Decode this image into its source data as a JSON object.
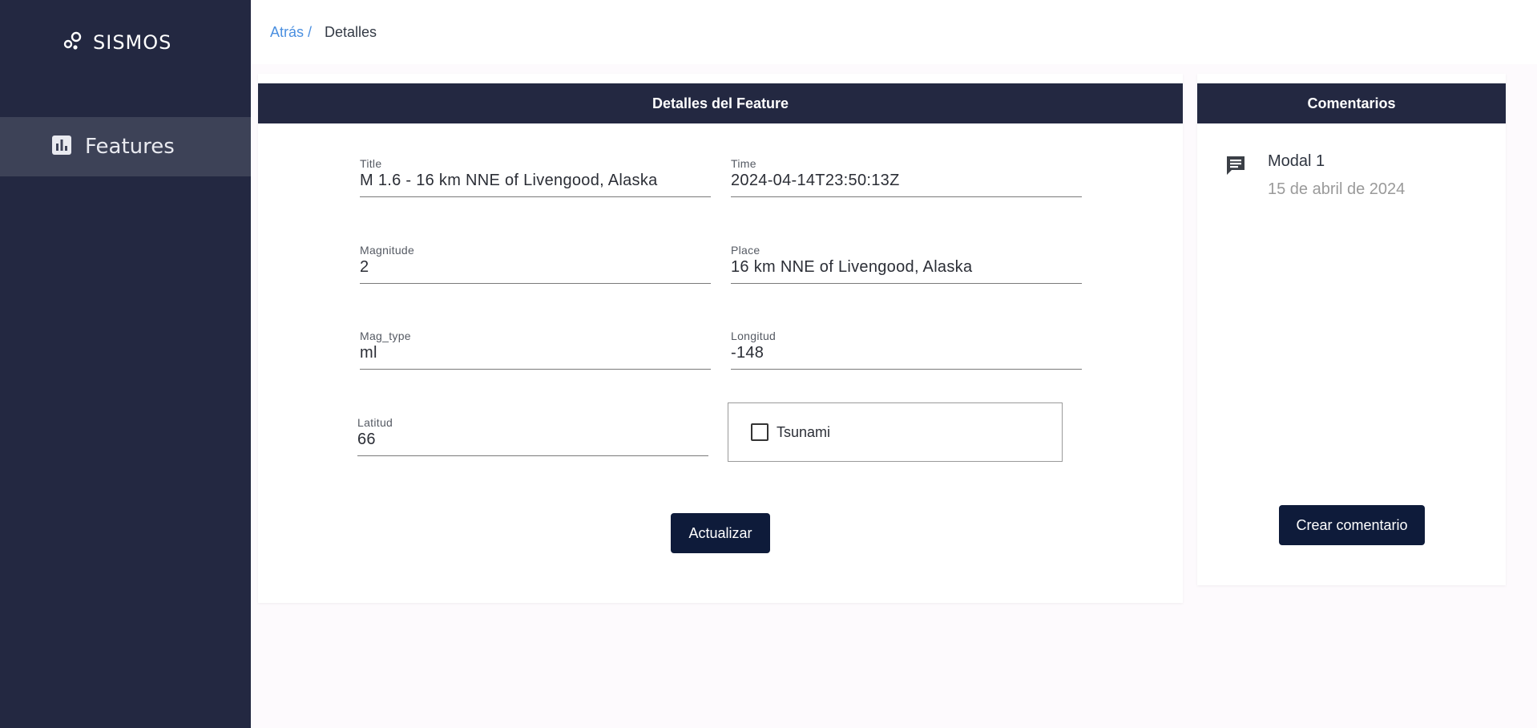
{
  "sidebar": {
    "brand": "SISMOS",
    "brand_icon": "bubbles-icon",
    "items": [
      {
        "label": "Features",
        "icon": "bar-chart-icon"
      }
    ],
    "colors": {
      "background": "#232841",
      "active": "#3d4257"
    }
  },
  "breadcrumb": {
    "back": "Atrás /",
    "current": "Detalles"
  },
  "details": {
    "header": "Detalles del Feature",
    "fields": {
      "title": {
        "label": "Title",
        "value": "M 1.6 - 16 km NNE of Livengood, Alaska"
      },
      "time": {
        "label": "Time",
        "value": "2024-04-14T23:50:13Z"
      },
      "magnitude": {
        "label": "Magnitude",
        "value": "2"
      },
      "place": {
        "label": "Place",
        "value": "16 km NNE of Livengood, Alaska"
      },
      "mag_type": {
        "label": "Mag_type",
        "value": "ml"
      },
      "longitud": {
        "label": "Longitud",
        "value": "-148"
      },
      "latitud": {
        "label": "Latitud",
        "value": "66"
      }
    },
    "tsunami": {
      "label": "Tsunami",
      "checked": false
    },
    "update_button": "Actualizar"
  },
  "comments": {
    "header": "Comentarios",
    "items": [
      {
        "icon": "comment-icon",
        "title": "Modal 1",
        "date": "15 de abril de 2024"
      }
    ],
    "create_button": "Crear comentario"
  },
  "colors": {
    "header_bg": "#232841",
    "button_bg": "#0e1b3a",
    "link": "#4a8fe0"
  }
}
